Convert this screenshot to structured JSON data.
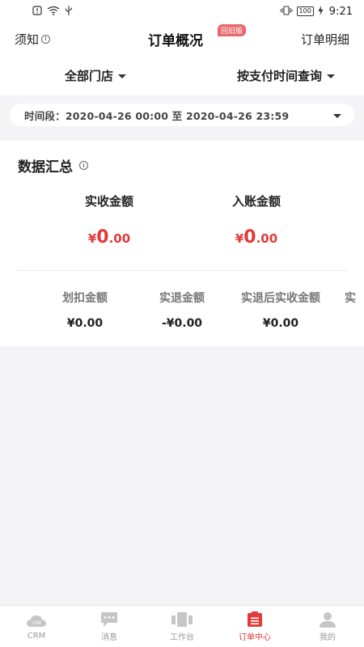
{
  "status_bar": {
    "time": "9:21",
    "battery": "100"
  },
  "nav": {
    "help_label": "须知",
    "title": "订单概况",
    "badge": "回旧版",
    "right_link": "订单明细"
  },
  "filters": {
    "store": "全部门店",
    "query_mode": "按支付时间查询"
  },
  "date_range": {
    "label": "时间段：",
    "start": "2020-04-26 00:00",
    "separator": "至",
    "end": "2020-04-26 23:59"
  },
  "summary": {
    "title": "数据汇总",
    "primary": [
      {
        "label": "实收金额",
        "symbol": "¥",
        "int": "0",
        "dec": ".00"
      },
      {
        "label": "入账金额",
        "symbol": "¥",
        "int": "0",
        "dec": ".00"
      }
    ],
    "secondary": [
      {
        "label": "划扣金额",
        "value": "¥0.00"
      },
      {
        "label": "实退金额",
        "value": "-¥0.00"
      },
      {
        "label": "实退后实收金额",
        "value": "¥0.00"
      },
      {
        "label": "实",
        "value": ""
      }
    ]
  },
  "tabs": [
    {
      "label": "CRM",
      "icon": "crm-cloud-icon",
      "active": false
    },
    {
      "label": "消息",
      "icon": "message-icon",
      "active": false
    },
    {
      "label": "工作台",
      "icon": "workbench-icon",
      "active": false
    },
    {
      "label": "订单中心",
      "icon": "order-center-icon",
      "active": true
    },
    {
      "label": "我的",
      "icon": "profile-icon",
      "active": false
    }
  ],
  "colors": {
    "accent": "#e23a3a",
    "badge": "#e8686e",
    "inactive_icon": "#c6c6c6"
  }
}
